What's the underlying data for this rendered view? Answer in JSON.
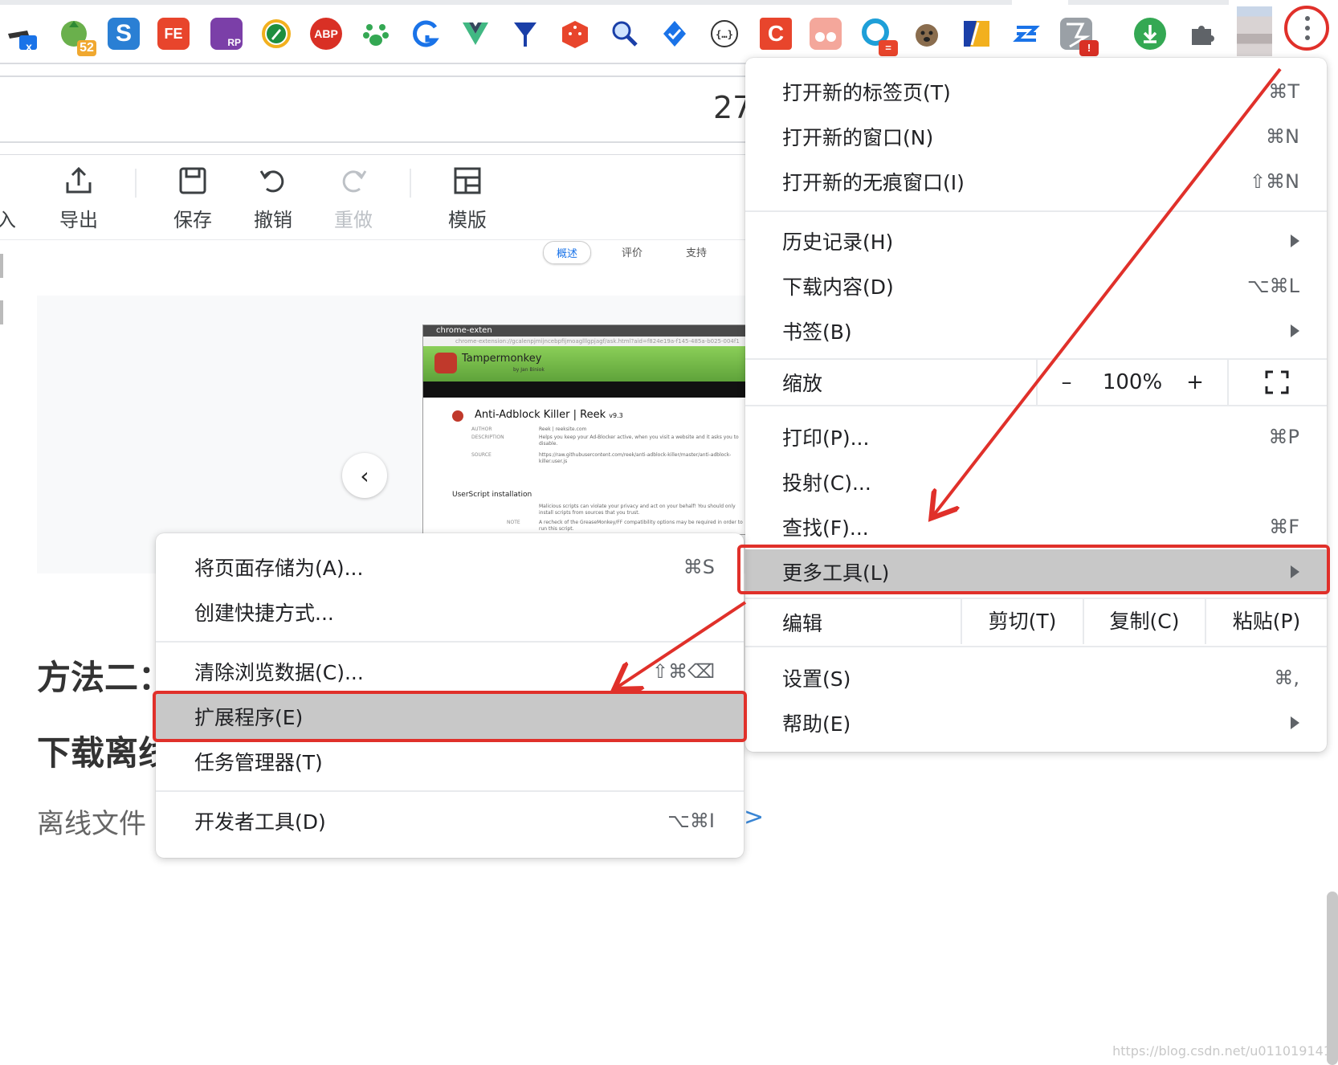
{
  "extension_badges": {
    "visual_search": "x",
    "count": "52",
    "fe": "FE",
    "rp": "RP",
    "abp": "ABP",
    "c_ext": "C",
    "doc": "=",
    "alert": "!"
  },
  "page": {
    "page_number": "27",
    "toolbar": {
      "import_partial": "入",
      "export": "导出",
      "save": "保存",
      "undo": "撤销",
      "redo": "重做",
      "template": "模版"
    },
    "store_tabs": [
      "概述",
      "评价",
      "支持"
    ],
    "screenshot": {
      "tab": "chrome-exten",
      "url": "chrome-extension://gcalenpjmijncebpfijmoaglllgpjagf/ask.html?aid=f824e19a-f145-485a-b025-004f1",
      "app_name": "Tampermonkey",
      "app_by": "by Jan Biniok",
      "script_title": "Anti-Adblock Killer | Reek",
      "script_version": "v9.3",
      "author_label": "AUTHOR",
      "author_value": "Reek | reeksite.com",
      "description_label": "DESCRIPTION",
      "description_value": "Helps you keep your Ad-Blocker active, when you visit a website and it asks you to disable.",
      "source_label": "SOURCE",
      "source_value": "https://raw.githubusercontent.com/reek/anti-adblock-killer/master/anti-adblock-killer.user.js",
      "install_heading": "UserScript installation",
      "warning_text": "Malicious scripts can violate your privacy and act on your behalf! You should only install scripts from sources that you trust.",
      "note_label": "NOTE",
      "note_value": "A recheck of the GreaseMonkey/FF compatibility options may be required in order to run this script."
    },
    "heading_1": "方法二：",
    "heading_2": "下载离线",
    "paragraph": "离线文件",
    "link_arrow": ">",
    "watermark": "https://blog.csdn.net/u011019141"
  },
  "main_menu": {
    "items": [
      {
        "label": "打开新的标签页(T)",
        "shortcut": "⌘T"
      },
      {
        "label": "打开新的窗口(N)",
        "shortcut": "⌘N"
      },
      {
        "label": "打开新的无痕窗口(I)",
        "shortcut": "⇧⌘N"
      },
      {
        "label": "历史记录(H)",
        "shortcut": ""
      },
      {
        "label": "下载内容(D)",
        "shortcut": "⌥⌘L"
      },
      {
        "label": "书签(B)",
        "shortcut": ""
      },
      {
        "label": "打印(P)...",
        "shortcut": "⌘P"
      },
      {
        "label": "投射(C)...",
        "shortcut": ""
      },
      {
        "label": "查找(F)...",
        "shortcut": "⌘F"
      },
      {
        "label": "更多工具(L)",
        "shortcut": ""
      },
      {
        "label": "设置(S)",
        "shortcut": "⌘,"
      },
      {
        "label": "帮助(E)",
        "shortcut": ""
      }
    ],
    "zoom": {
      "label": "缩放",
      "minus": "–",
      "value": "100%",
      "plus": "+"
    },
    "edit": {
      "label": "编辑",
      "cut": "剪切(T)",
      "copy": "复制(C)",
      "paste": "粘贴(P)"
    }
  },
  "submenu": {
    "items": [
      {
        "label": "将页面存储为(A)...",
        "shortcut": "⌘S"
      },
      {
        "label": "创建快捷方式...",
        "shortcut": ""
      },
      {
        "label": "清除浏览数据(C)...",
        "shortcut": "⇧⌘⌫"
      },
      {
        "label": "扩展程序(E)",
        "shortcut": ""
      },
      {
        "label": "任务管理器(T)",
        "shortcut": ""
      },
      {
        "label": "开发者工具(D)",
        "shortcut": "⌥⌘I"
      }
    ]
  },
  "colors": {
    "annotation_red": "#e0302a",
    "menu_highlight": "#c8c8c8",
    "link_blue": "#3a86d4"
  }
}
